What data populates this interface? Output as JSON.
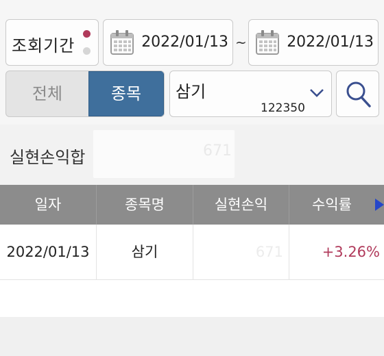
{
  "filter": {
    "period_label": "조회기간",
    "start_date": "2022/01/13",
    "separator": "~",
    "end_date": "2022/01/13",
    "segment_all": "전체",
    "segment_item": "종목",
    "stock_name": "삼기",
    "stock_code": "122350"
  },
  "summary": {
    "label": "실현손익합",
    "value": "671"
  },
  "table": {
    "headers": [
      "일자",
      "종목명",
      "실현손익",
      "수익률"
    ],
    "rows": [
      {
        "date": "2022/01/13",
        "name": "삼기",
        "realized": "671",
        "return": "+3.26%"
      }
    ]
  },
  "colors": {
    "accent": "#3f6f9c",
    "header_bg": "#8c8c8c",
    "positive": "#b03a5b",
    "arrow": "#2647c9"
  },
  "icons": [
    "calendar-icon",
    "chevron-down-icon",
    "search-icon",
    "scroll-right-arrow-icon"
  ]
}
